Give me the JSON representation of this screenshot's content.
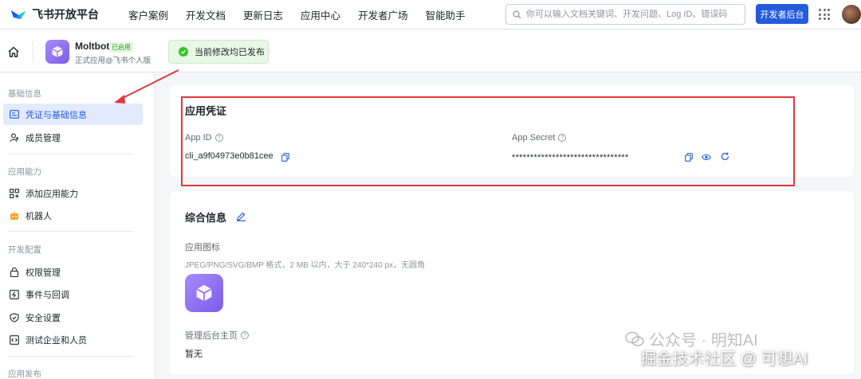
{
  "topnav": {
    "logo_text": "飞书开放平台",
    "links": [
      "客户案例",
      "开发文档",
      "更新日志",
      "应用中心",
      "开发者广场",
      "智能助手"
    ],
    "search_placeholder": "你可以输入文档关键词、开发问题、Log ID、错误码",
    "dev_console_label": "开发者后台"
  },
  "app": {
    "name": "Moltbot",
    "badge": "已启用",
    "subtitle": "正式应用@飞书个人版",
    "toast": "当前修改均已发布"
  },
  "sidebar": {
    "groups": [
      {
        "title": "基础信息",
        "items": [
          {
            "label": "凭证与基础信息",
            "icon": "id-card-icon",
            "active": true
          },
          {
            "label": "成员管理",
            "icon": "user-add-icon",
            "active": false
          }
        ]
      },
      {
        "title": "应用能力",
        "items": [
          {
            "label": "添加应用能力",
            "icon": "grid-add-icon",
            "active": false
          },
          {
            "label": "机器人",
            "icon": "robot-icon",
            "active": false
          }
        ]
      },
      {
        "title": "开发配置",
        "items": [
          {
            "label": "权限管理",
            "icon": "lock-icon",
            "active": false
          },
          {
            "label": "事件与回调",
            "icon": "event-icon",
            "active": false
          },
          {
            "label": "安全设置",
            "icon": "shield-icon",
            "active": false
          },
          {
            "label": "测试企业和人员",
            "icon": "code-icon",
            "active": false
          }
        ]
      },
      {
        "title": "应用发布",
        "items": []
      }
    ]
  },
  "credentials": {
    "title": "应用凭证",
    "app_id_label": "App ID",
    "app_id_value": "cli_a9f04973e0b81cee",
    "app_secret_label": "App Secret",
    "app_secret_value": "********************************"
  },
  "general": {
    "title": "综合信息",
    "icon_label": "应用图标",
    "icon_hint": "JPEG/PNG/SVG/BMP 格式，2 MB 以内，大于 240*240 px，无圆角",
    "homepage_label": "管理后台主页",
    "homepage_value": "暂无"
  },
  "watermark": {
    "line1": "公众号 · 明知AI",
    "line2": "掘金技术社区 @ 可想AI"
  },
  "colors": {
    "primary": "#245bdb",
    "highlight_border": "#e0383e",
    "app_icon": "#8b6cf0",
    "success": "#34c724"
  }
}
